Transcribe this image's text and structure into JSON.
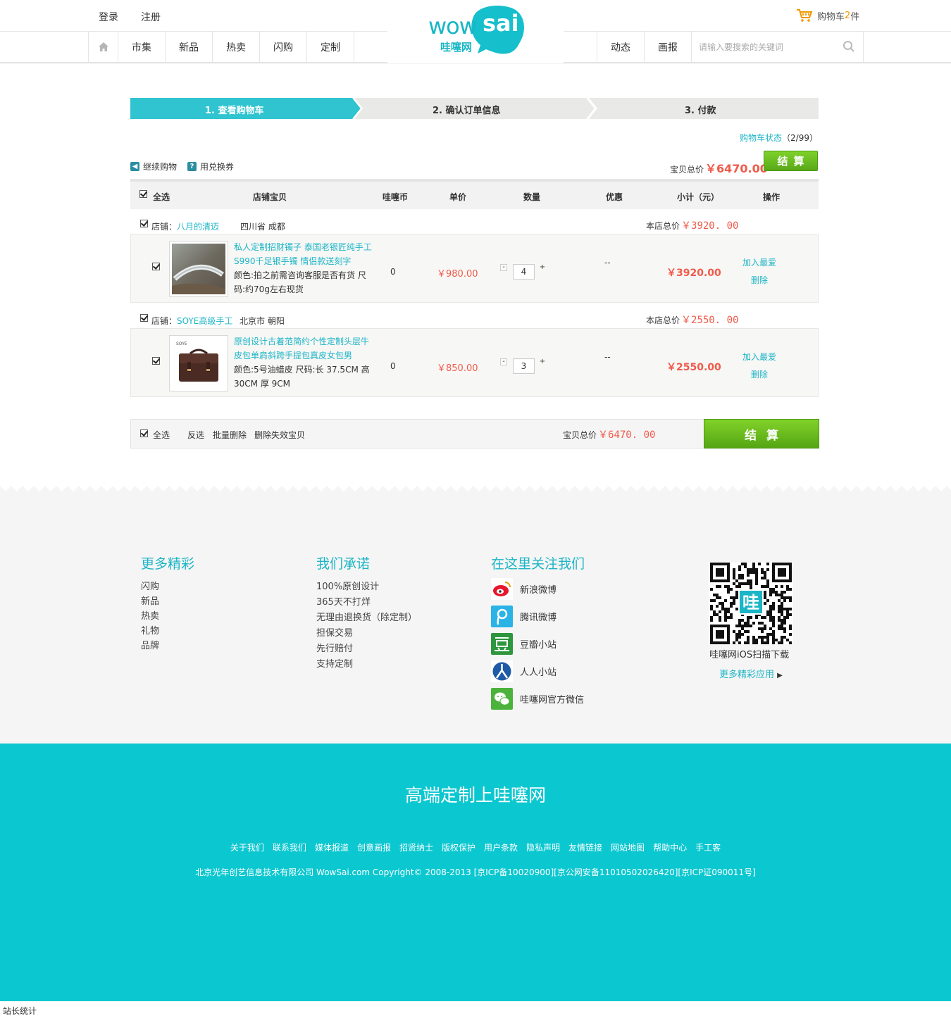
{
  "header": {
    "login": "登录",
    "register": "注册",
    "cart_label": "购物车",
    "cart_count": "2",
    "cart_unit": "件",
    "nav_left": [
      "市集",
      "新品",
      "热卖",
      "闪购",
      "定制"
    ],
    "nav_right": [
      "动态",
      "画报"
    ],
    "search_placeholder": "请输入要搜索的关键词",
    "logo_en": "wowsai",
    "logo_cn": "哇噻网"
  },
  "steps": [
    "1. 查看购物车",
    "2. 确认订单信息",
    "3. 付款"
  ],
  "cart_status": {
    "label": "购物车状态",
    "count": "（2/99）"
  },
  "toolbar": {
    "continue": "继续购物",
    "coupon": "用兑换券"
  },
  "total_top": {
    "label": "宝贝总价",
    "value": "￥6470.00"
  },
  "checkout_label": "结算",
  "table_head": [
    "全选",
    "店铺宝贝",
    "哇噻币",
    "单价",
    "数量",
    "优惠",
    "小计（元）",
    "操作"
  ],
  "shops": [
    {
      "label": "店铺：",
      "name": "八月的清迈",
      "location": "四川省 成都",
      "total_label": "本店总价",
      "total": "￥3920. 00",
      "item": {
        "title": "私人定制招财镯子 泰国老银匠纯手工S990千足银手镯 情侣款送刻字",
        "spec": "颜色:拍之前需咨询客服是否有货 尺码:约70g左右现货",
        "coin": "0",
        "price": "￥980.00",
        "qty": "4",
        "discount": "--",
        "subtotal": "￥3920.00",
        "fav": "加入最爱",
        "del": "删除"
      }
    },
    {
      "label": "店铺：",
      "name": "SOYE高级手工",
      "location": "北京市 朝阳",
      "total_label": "本店总价",
      "total": "￥2550. 00",
      "item": {
        "title": "原创设计古着范简约个性定制头层牛皮包单肩斜跨手提包真皮女包男",
        "spec": "颜色:5号油蜡皮 尺码:长 37.5CM 高30CM 厚 9CM",
        "coin": "0",
        "price": "￥850.00",
        "qty": "3",
        "discount": "--",
        "subtotal": "￥2550.00",
        "fav": "加入最爱",
        "del": "删除"
      }
    }
  ],
  "bottom_bar": {
    "select_all": "全选",
    "invert": "反选",
    "batch_delete": "批量删除",
    "delete_invalid": "删除失效宝贝",
    "total_label": "宝贝总价",
    "total": "￥6470. 00"
  },
  "footer": {
    "col1_title": "更多精彩",
    "col1_items": [
      "闪购",
      "新品",
      "热卖",
      "礼物",
      "品牌"
    ],
    "col2_title": "我们承诺",
    "col2_items": [
      "100%原创设计",
      "365天不打烊",
      "无理由退换货（除定制）",
      "担保交易",
      "先行赔付",
      "支持定制"
    ],
    "col3_title": "在这里关注我们",
    "social": [
      "新浪微博",
      "腾讯微博",
      "豆瓣小站",
      "人人小站",
      "哇噻网官方微信"
    ],
    "qr_caption": "哇噻网iOS扫描下载",
    "more_apps": "更多精彩应用",
    "slogan": "高端定制上哇噻网",
    "links": [
      "关于我们",
      "联系我们",
      "媒体报道",
      "创意画报",
      "招贤纳士",
      "版权保护",
      "用户条款",
      "隐私声明",
      "友情链接",
      "网站地图",
      "帮助中心",
      "手工客"
    ],
    "copyright": "北京光年创艺信息技术有限公司 WowSai.com Copyright© 2008-2013 [京ICP备10020900][京公网安备11010502026420][京ICP证090011号]",
    "stat": "站长统计"
  },
  "colors": {
    "accent": "#1cb5c6",
    "price": "#f05a4a",
    "checkout": "#6cbf22",
    "footer_bg": "#0bc7d0"
  }
}
